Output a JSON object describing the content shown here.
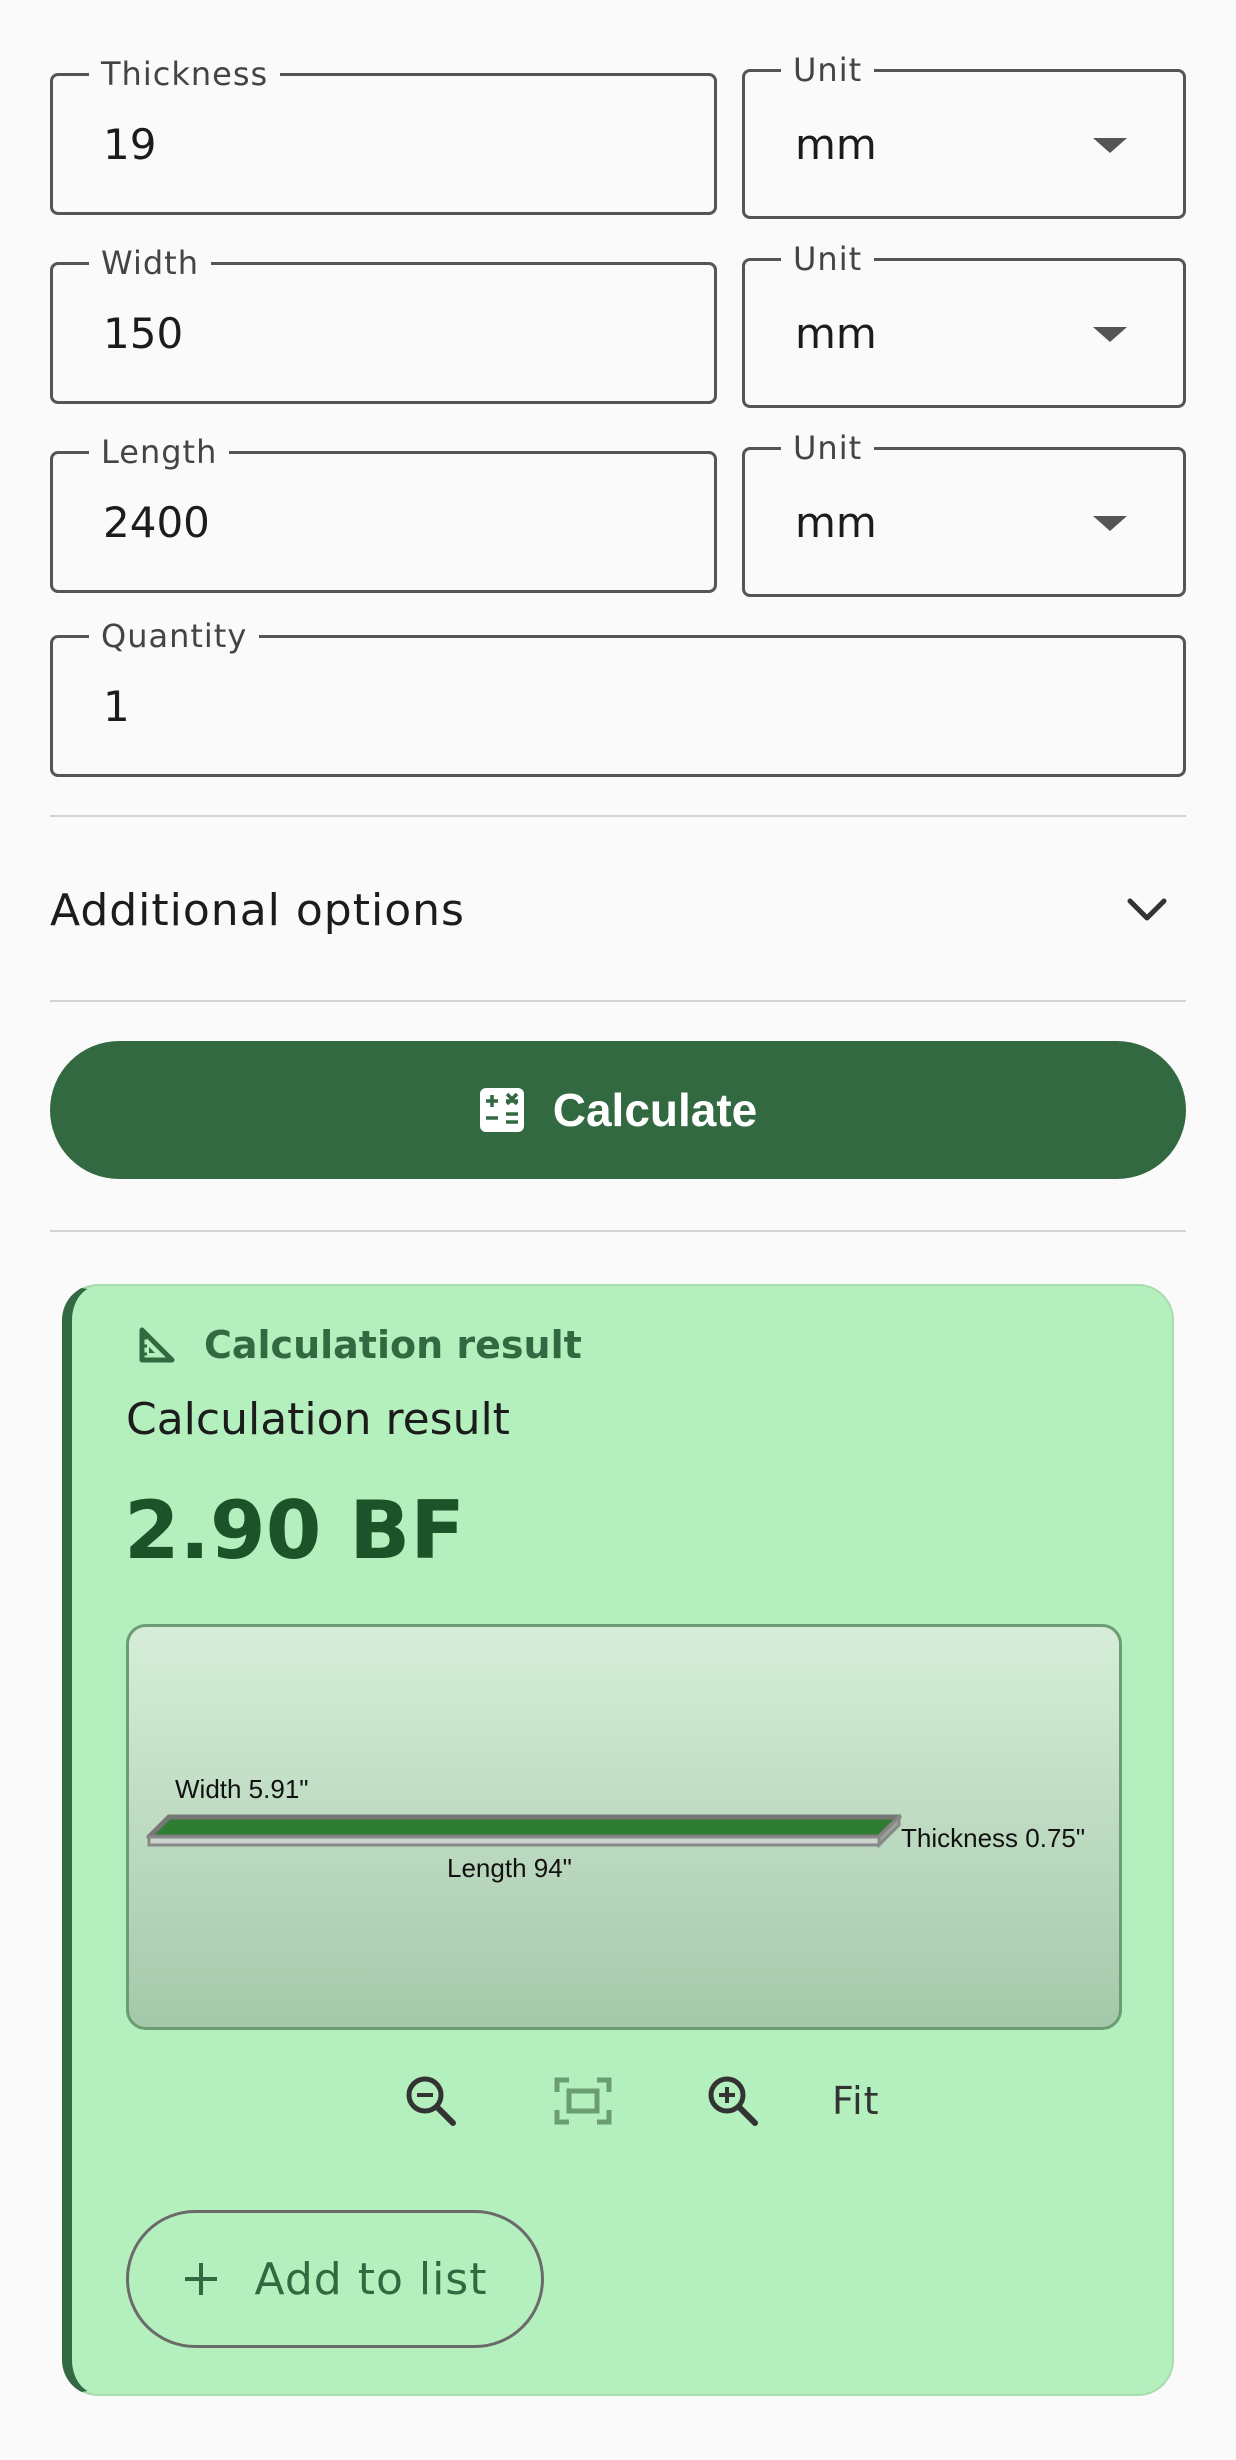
{
  "fields": {
    "thickness": {
      "label": "Thickness",
      "value": "19"
    },
    "thickness_unit": {
      "label": "Unit",
      "value": "mm"
    },
    "width": {
      "label": "Width",
      "value": "150"
    },
    "width_unit": {
      "label": "Unit",
      "value": "mm"
    },
    "length": {
      "label": "Length",
      "value": "2400"
    },
    "length_unit": {
      "label": "Unit",
      "value": "mm"
    },
    "quantity": {
      "label": "Quantity",
      "value": "1"
    }
  },
  "additional_options": {
    "label": "Additional options",
    "icon": "chevron-down-icon"
  },
  "calculate_button": {
    "label": "Calculate",
    "icon": "calculator-icon"
  },
  "result": {
    "header_icon": "set-square-icon",
    "header": "Calculation result",
    "subtitle": "Calculation result",
    "value": "2.90 BF",
    "diagram": {
      "width_label": "Width 5.91\"",
      "length_label": "Length 94\"",
      "thickness_label": "Thickness 0.75\""
    },
    "zoom_controls": {
      "zoom_out_icon": "zoom-out-icon",
      "fit_frame_icon": "fit-frame-icon",
      "zoom_in_icon": "zoom-in-icon",
      "fit_label": "Fit"
    },
    "add_button": {
      "label": "Add to list",
      "icon": "plus-icon"
    }
  },
  "colors": {
    "primary": "#336941",
    "card_background": "#b4f0bd",
    "board_fill": "#2e7d32",
    "page_background": "#fafafa"
  }
}
